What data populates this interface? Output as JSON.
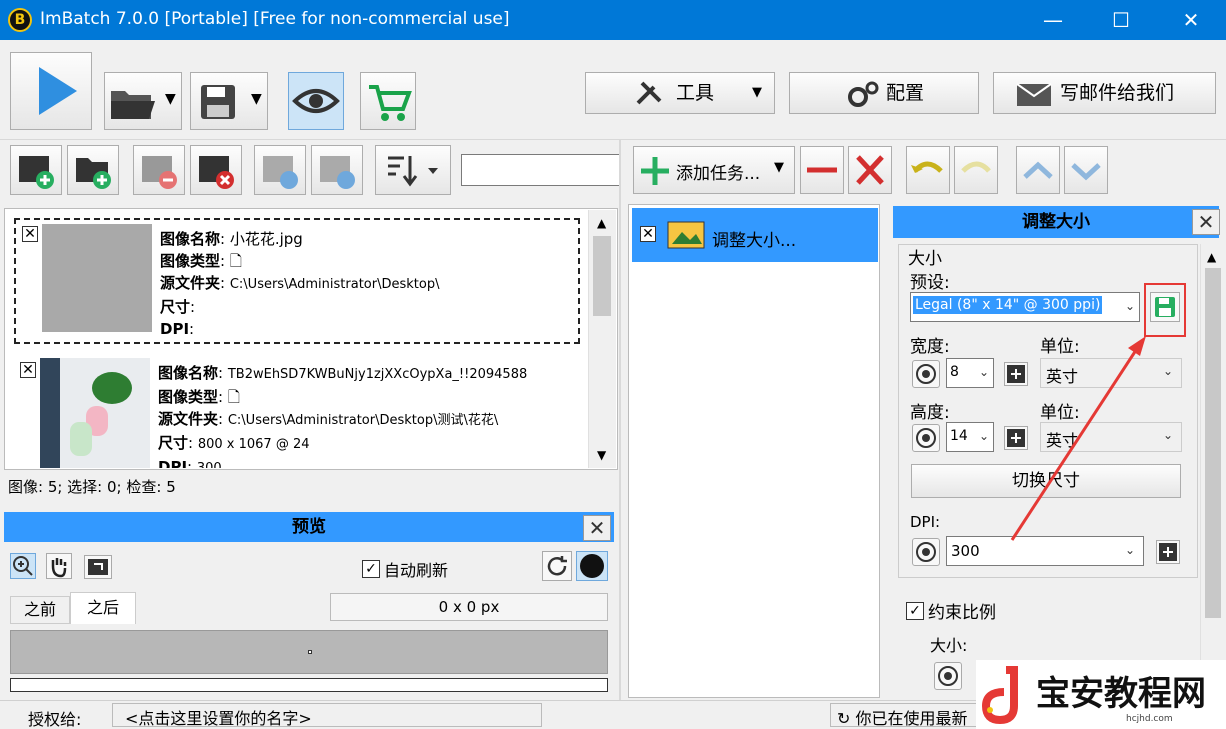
{
  "window": {
    "logo_letter": "B",
    "title": "ImBatch 7.0.0 [Portable] [Free for non-commercial use]",
    "minimize": "—",
    "maximize": "☐",
    "close": "✕"
  },
  "main_toolbar": {
    "tools_label": "工具",
    "config_label": "配置",
    "email_label": "写邮件给我们"
  },
  "task_toolbar": {
    "add_task_label": "添加任务..."
  },
  "images": {
    "items": [
      {
        "name_label": "图像名称",
        "name": "小花花.jpg",
        "type_label": "图像类型",
        "folder_label": "源文件夹",
        "folder": "C:\\Users\\Administrator\\Desktop\\",
        "size_label": "尺寸",
        "size": "",
        "dpi_label": "DPI",
        "dpi": ""
      },
      {
        "name_label": "图像名称",
        "name": "TB2wEhSD7KWBuNjy1zjXXcOypXa_!!2094588",
        "type_label": "图像类型",
        "folder_label": "源文件夹",
        "folder": "C:\\Users\\Administrator\\Desktop\\测试\\花花\\",
        "size_label": "尺寸",
        "size": "800 x 1067 @ 24",
        "dpi_label": "DPI",
        "dpi": "300"
      }
    ],
    "status": "图像: 5; 选择: 0; 检查: 5"
  },
  "preview": {
    "title": "预览",
    "auto_refresh": "自动刷新",
    "tab_before": "之前",
    "tab_after": "之后",
    "size_readout": "0 x 0 px"
  },
  "tasks": {
    "items": [
      {
        "label": "调整大小..."
      }
    ]
  },
  "resize": {
    "title": "调整大小",
    "group_label": "大小",
    "preset_label": "预设:",
    "preset_value": "Legal (8\" x 14\" @ 300 ppi)",
    "width_label": "宽度:",
    "width_value": "8",
    "unit_label_1": "单位:",
    "unit_value_1": "英寸",
    "height_label": "高度:",
    "height_value": "14",
    "unit_label_2": "单位:",
    "unit_value_2": "英寸",
    "swap_button": "切换尺寸",
    "dpi_label": "DPI:",
    "dpi_value": "300",
    "keep_ratio": "约束比例",
    "size_label2": "大小:"
  },
  "statusbar": {
    "license_label": "授权给:",
    "license_value": "<点击这里设置你的名字>",
    "update_text": "你已在使用最新"
  },
  "watermark": {
    "text": "宝安教程网",
    "sub": "hcjhd.com"
  },
  "colors": {
    "accent": "#0078d7",
    "panel_title": "#3399ff",
    "highlight_red": "#e53935",
    "green": "#27ae60",
    "play_blue": "#2f8fe0"
  }
}
